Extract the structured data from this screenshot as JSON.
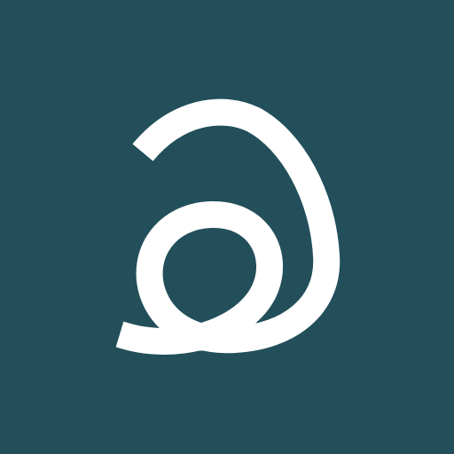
{
  "icon": {
    "name": "loop-logo-icon",
    "background_color": "#224f5a",
    "stroke_color": "#ffffff"
  }
}
